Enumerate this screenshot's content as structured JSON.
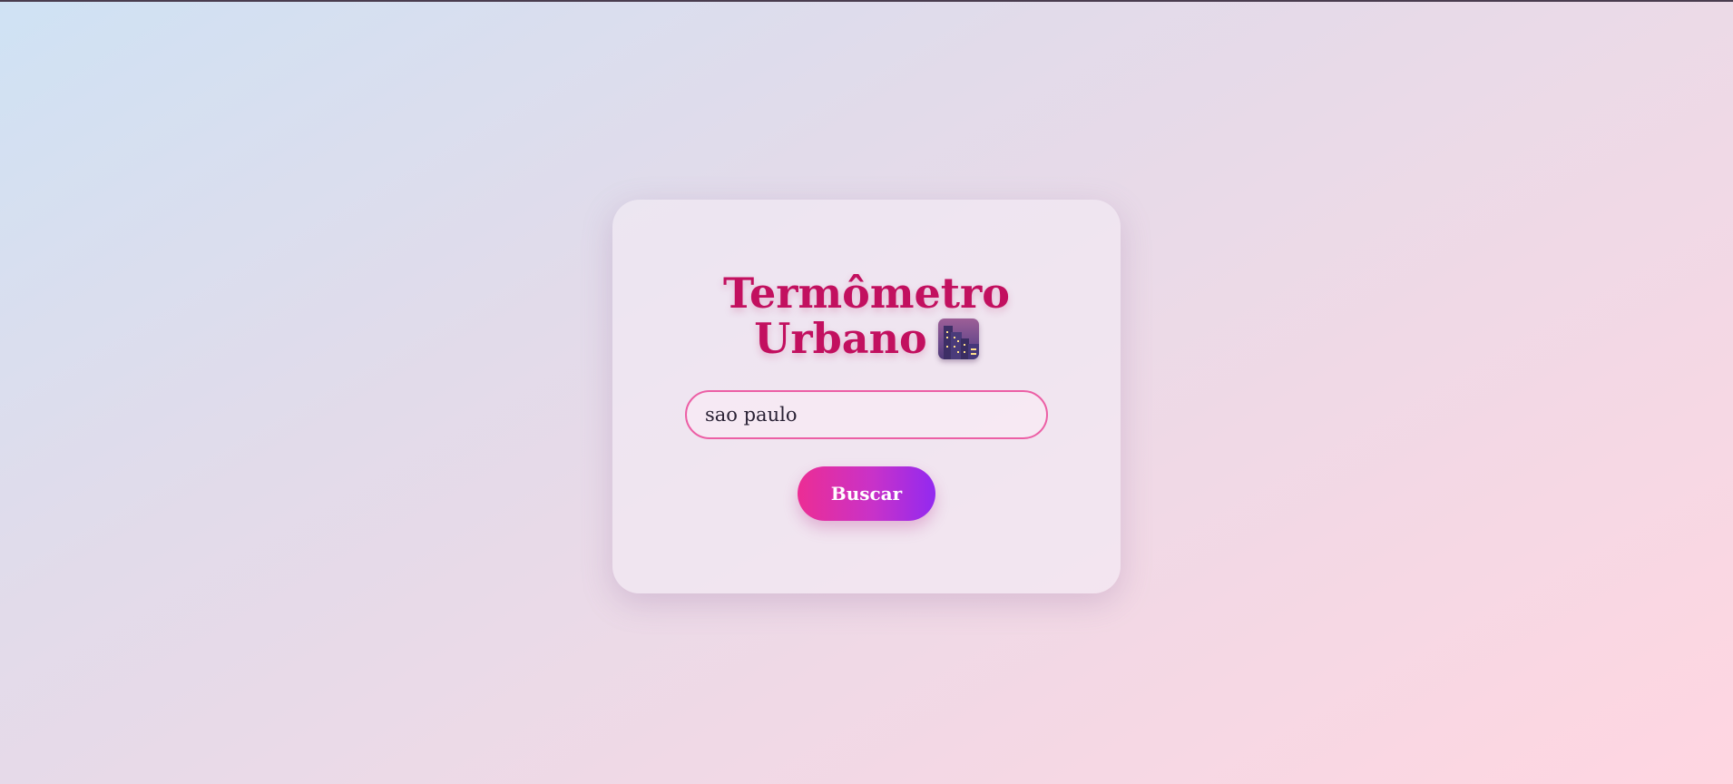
{
  "app": {
    "title_line1": "Termômetro",
    "title_line2": "Urbano",
    "title_icon": "night-city-icon"
  },
  "search": {
    "value": "sao paulo",
    "placeholder": ""
  },
  "actions": {
    "search_label": "Buscar"
  },
  "colors": {
    "title": "#c2105f",
    "input_border": "#ec5fa5",
    "button_gradient_start": "#ec2d94",
    "button_gradient_end": "#9229f0"
  }
}
